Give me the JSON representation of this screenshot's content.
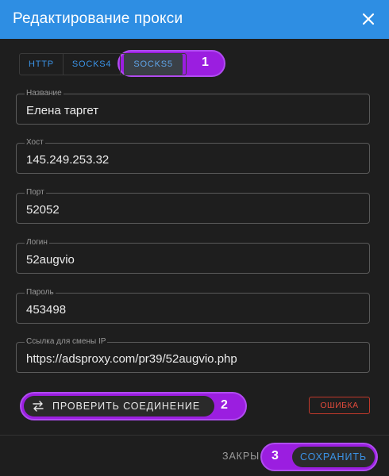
{
  "dialog": {
    "title": "Редактирование прокси"
  },
  "tabs": [
    {
      "label": "HTTP"
    },
    {
      "label": "SOCKS4"
    },
    {
      "label": "SOCKS5"
    }
  ],
  "annotations": [
    "1",
    "2",
    "3"
  ],
  "fields": {
    "name": {
      "label": "Название",
      "value": "Елена таргет"
    },
    "host": {
      "label": "Хост",
      "value": "145.249.253.32"
    },
    "port": {
      "label": "Порт",
      "value": "52052"
    },
    "login": {
      "label": "Логин",
      "value": "52augvio"
    },
    "password": {
      "label": "Пароль",
      "value": "453498"
    },
    "change_ip_url": {
      "label": "Ссылка для смены IP",
      "value": "https://adsproxy.com/pr39/52augvio.php"
    }
  },
  "actions": {
    "check_connection": "ПРОВЕРИТЬ СОЕДИНЕНИЕ",
    "status": "ОШИБКА",
    "close": "ЗАКРЫ",
    "save": "СОХРАНИТЬ"
  },
  "colors": {
    "header": "#2e8ee3",
    "accent": "#3b93e6",
    "highlight": "#9b1ee0",
    "error": "#e04a3b"
  },
  "icons": {
    "close": "close-icon",
    "swap": "swap-arrows-icon"
  }
}
